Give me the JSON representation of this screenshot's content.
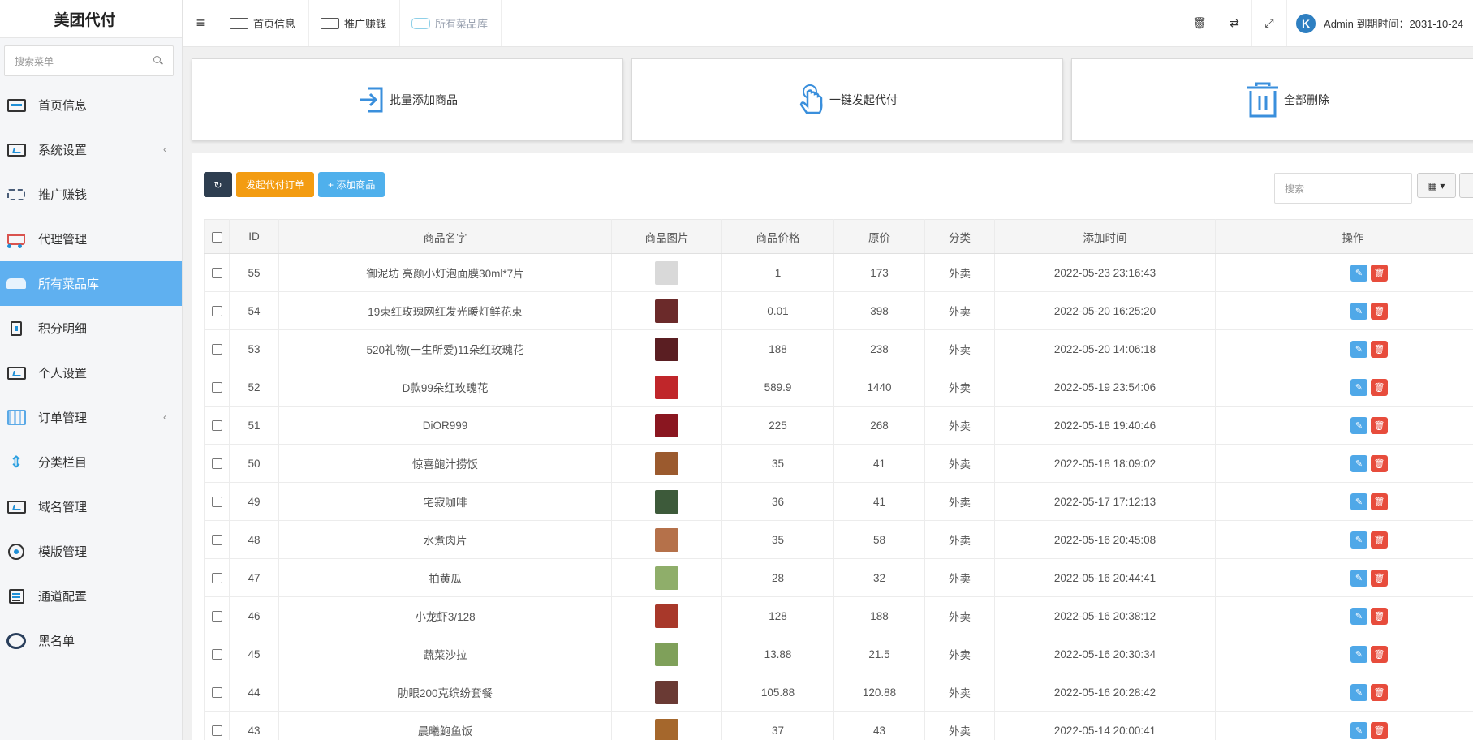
{
  "sidebar": {
    "logo": "美团代付",
    "search_placeholder": "搜索菜单",
    "items": [
      {
        "label": "首页信息",
        "icon": "monitor-icon",
        "has_arrow": false
      },
      {
        "label": "系统设置",
        "icon": "settings-screen-icon",
        "has_arrow": true
      },
      {
        "label": "推广赚钱",
        "icon": "megaphone-icon",
        "has_arrow": false
      },
      {
        "label": "代理管理",
        "icon": "cart-icon",
        "has_arrow": false
      },
      {
        "label": "所有菜品库",
        "icon": "bus-icon",
        "has_arrow": false,
        "active": true
      },
      {
        "label": "积分明细",
        "icon": "clipboard-icon",
        "has_arrow": false
      },
      {
        "label": "个人设置",
        "icon": "settings-screen-icon",
        "has_arrow": false
      },
      {
        "label": "订单管理",
        "icon": "grid-icon",
        "has_arrow": true
      },
      {
        "label": "分类栏目",
        "icon": "tree-icon",
        "has_arrow": false
      },
      {
        "label": "域名管理",
        "icon": "screen-icon",
        "has_arrow": false
      },
      {
        "label": "模版管理",
        "icon": "disc-icon",
        "has_arrow": false
      },
      {
        "label": "通道配置",
        "icon": "card-icon",
        "has_arrow": false
      },
      {
        "label": "黑名单",
        "icon": "ring-icon",
        "has_arrow": false
      }
    ],
    "arrow_glyph": "‹"
  },
  "topbar": {
    "menu_glyph": "≡",
    "tabs": [
      {
        "label": "首页信息",
        "current": false
      },
      {
        "label": "推广赚钱",
        "current": false
      },
      {
        "label": "所有菜品库",
        "current": true
      }
    ],
    "tools": [
      {
        "name": "trash-icon",
        "glyph": "🗑"
      },
      {
        "name": "translate-icon",
        "glyph": "⇄"
      },
      {
        "name": "fullscreen-icon",
        "glyph": "⤢"
      }
    ],
    "avatar_letter": "K",
    "user_text": "Admin 到期时间：2031-10-24"
  },
  "cards": [
    {
      "label": "批量添加商品",
      "icon": "import-icon"
    },
    {
      "label": "一键发起代付",
      "icon": "hand-pointer-icon"
    },
    {
      "label": "全部删除",
      "icon": "trash-icon"
    }
  ],
  "toolbar": {
    "refresh_glyph": "↻",
    "start_order_label": "发起代付订单",
    "add_product_label": "+ 添加商品",
    "search_placeholder": "搜索",
    "columns_glyph": "▦ ▾"
  },
  "accent_color": "#5fb0f0",
  "table": {
    "headers": [
      "",
      "ID",
      "商品名字",
      "商品图片",
      "商品价格",
      "原价",
      "分类",
      "添加时间",
      "操作"
    ],
    "rows": [
      {
        "id": "55",
        "name": "御泥坊 亮颜小灯泡面膜30ml*7片",
        "price": "1",
        "original": "173",
        "category": "外卖",
        "time": "2022-05-23 23:16:43",
        "thumb": "#d9d9d9"
      },
      {
        "id": "54",
        "name": "19束红玫瑰网红发光暖灯鲜花束",
        "price": "0.01",
        "original": "398",
        "category": "外卖",
        "time": "2022-05-20 16:25:20",
        "thumb": "#6b2a2a"
      },
      {
        "id": "53",
        "name": "520礼物(一生所爱)11朵红玫瑰花",
        "price": "188",
        "original": "238",
        "category": "外卖",
        "time": "2022-05-20 14:06:18",
        "thumb": "#5a1e22"
      },
      {
        "id": "52",
        "name": "D款99朵红玫瑰花",
        "price": "589.9",
        "original": "1440",
        "category": "外卖",
        "time": "2022-05-19 23:54:06",
        "thumb": "#c0262a"
      },
      {
        "id": "51",
        "name": "DiOR999",
        "price": "225",
        "original": "268",
        "category": "外卖",
        "time": "2022-05-18 19:40:46",
        "thumb": "#8a1620"
      },
      {
        "id": "50",
        "name": "惊喜鲍汁捞饭",
        "price": "35",
        "original": "41",
        "category": "外卖",
        "time": "2022-05-18 18:09:02",
        "thumb": "#9b5a2e"
      },
      {
        "id": "49",
        "name": "宅寂咖啡",
        "price": "36",
        "original": "41",
        "category": "外卖",
        "time": "2022-05-17 17:12:13",
        "thumb": "#3d5a3a"
      },
      {
        "id": "48",
        "name": "水煮肉片",
        "price": "35",
        "original": "58",
        "category": "外卖",
        "time": "2022-05-16 20:45:08",
        "thumb": "#b5714a"
      },
      {
        "id": "47",
        "name": "拍黄瓜",
        "price": "28",
        "original": "32",
        "category": "外卖",
        "time": "2022-05-16 20:44:41",
        "thumb": "#8fae6a"
      },
      {
        "id": "46",
        "name": "小龙虾3/128",
        "price": "128",
        "original": "188",
        "category": "外卖",
        "time": "2022-05-16 20:38:12",
        "thumb": "#a8382a"
      },
      {
        "id": "45",
        "name": "蔬菜沙拉",
        "price": "13.88",
        "original": "21.5",
        "category": "外卖",
        "time": "2022-05-16 20:30:34",
        "thumb": "#7fa05a"
      },
      {
        "id": "44",
        "name": "肋眼200克缤纷套餐",
        "price": "105.88",
        "original": "120.88",
        "category": "外卖",
        "time": "2022-05-16 20:28:42",
        "thumb": "#6a3a34"
      },
      {
        "id": "43",
        "name": "晨曦鲍鱼饭",
        "price": "37",
        "original": "43",
        "category": "外卖",
        "time": "2022-05-14 20:00:41",
        "thumb": "#a5672c"
      }
    ]
  }
}
